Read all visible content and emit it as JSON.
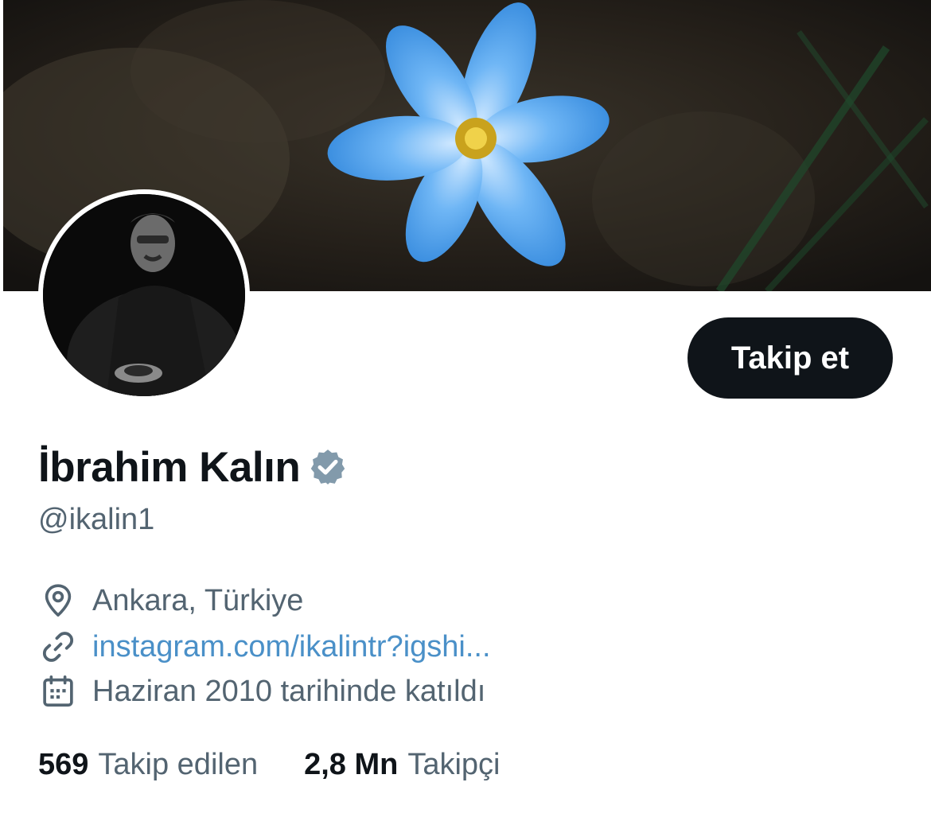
{
  "profile": {
    "name": "İbrahim Kalın",
    "handle": "@ikalin1",
    "follow_label": "Takip et",
    "location": "Ankara, Türkiye",
    "link": "instagram.com/ikalintr?igshi...",
    "joined": "Haziran 2010 tarihinde katıldı",
    "following_count": "569",
    "following_label": "Takip edilen",
    "followers_count": "2,8 Mn",
    "followers_label": "Takipçi"
  },
  "icons": {
    "verified": "verified-badge-icon",
    "location": "location-pin-icon",
    "link": "link-icon",
    "joined": "calendar-icon"
  },
  "colors": {
    "text_primary": "#0f1419",
    "text_secondary": "#536471",
    "link": "#4a90c8",
    "button_bg": "#0f1419",
    "button_text": "#ffffff",
    "verified_badge": "#829aab"
  }
}
